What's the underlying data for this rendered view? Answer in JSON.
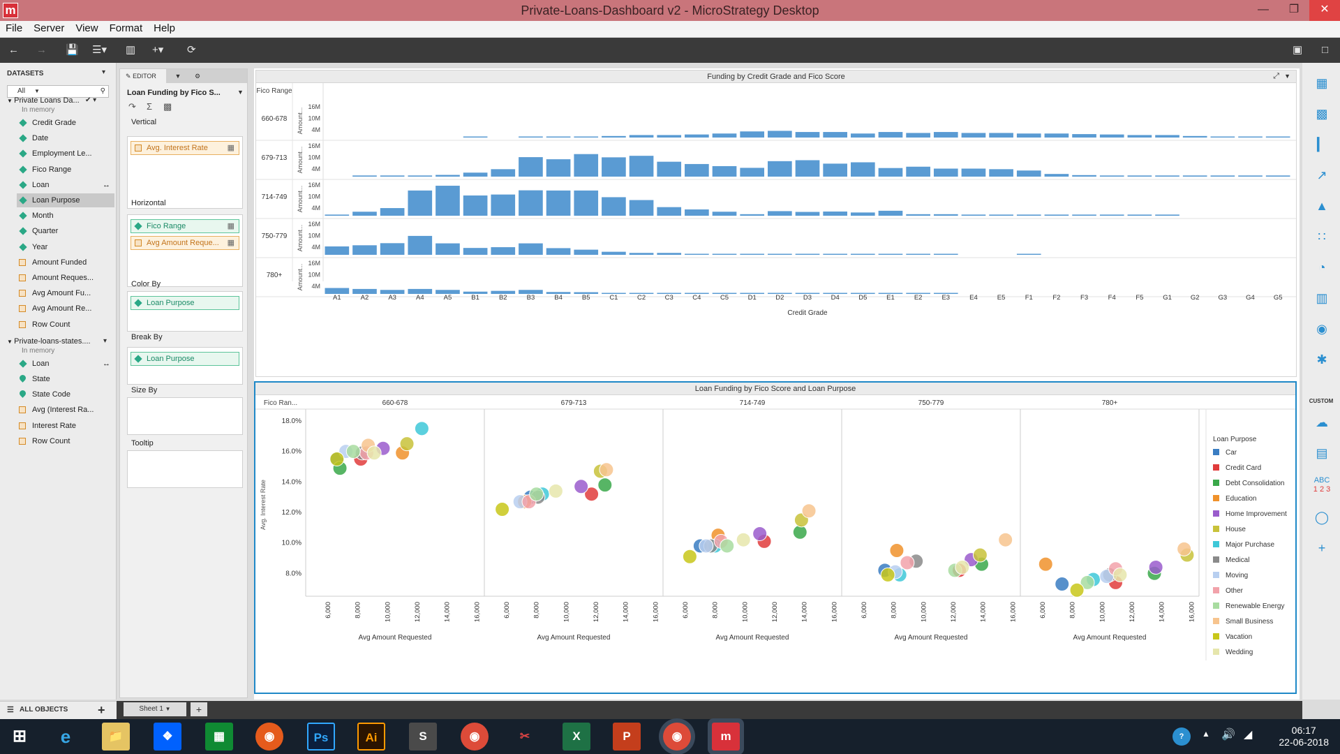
{
  "window": {
    "title": "Private-Loans-Dashboard v2 - MicroStrategy Desktop",
    "app_icon": "m"
  },
  "menu": [
    "File",
    "Server",
    "View",
    "Format",
    "Help"
  ],
  "datasets": {
    "header": "DATASETS",
    "filter": "All",
    "groups": [
      {
        "name": "Private Loans Da...",
        "status": "In memory",
        "items": [
          {
            "label": "Credit Grade",
            "kind": "attr"
          },
          {
            "label": "Date",
            "kind": "attr"
          },
          {
            "label": "Employment Le...",
            "kind": "attr"
          },
          {
            "label": "Fico Range",
            "kind": "attr"
          },
          {
            "label": "Loan",
            "kind": "attr"
          },
          {
            "label": "Loan Purpose",
            "kind": "attr",
            "selected": true
          },
          {
            "label": "Month",
            "kind": "attr"
          },
          {
            "label": "Quarter",
            "kind": "attr"
          },
          {
            "label": "Year",
            "kind": "attr"
          },
          {
            "label": "Amount Funded",
            "kind": "metric"
          },
          {
            "label": "Amount Reques...",
            "kind": "metric"
          },
          {
            "label": "Avg Amount Fu...",
            "kind": "metric"
          },
          {
            "label": "Avg Amount Re...",
            "kind": "metric"
          },
          {
            "label": "Row Count",
            "kind": "metric"
          }
        ]
      },
      {
        "name": "Private-loans-states....",
        "status": "In memory",
        "items": [
          {
            "label": "Loan",
            "kind": "attr"
          },
          {
            "label": "State",
            "kind": "geo"
          },
          {
            "label": "State Code",
            "kind": "geo"
          },
          {
            "label": "Avg (Interest Ra...",
            "kind": "metric"
          },
          {
            "label": "Interest Rate",
            "kind": "metric"
          },
          {
            "label": "Row Count",
            "kind": "metric"
          }
        ]
      }
    ],
    "all_objects": "ALL OBJECTS"
  },
  "editor": {
    "tab": "EDITOR",
    "title": "Loan Funding by Fico S...",
    "zones": [
      {
        "label": "Vertical",
        "pills": [
          {
            "text": "Avg. Interest Rate",
            "kind": "metric"
          }
        ]
      },
      {
        "label": "Horizontal",
        "pills": [
          {
            "text": "Fico Range",
            "kind": "attr"
          },
          {
            "text": "Avg Amount Reque...",
            "kind": "metric"
          }
        ]
      },
      {
        "label": "Color By",
        "pills": [
          {
            "text": "Loan Purpose",
            "kind": "attr"
          }
        ]
      },
      {
        "label": "Break By",
        "pills": [
          {
            "text": "Loan Purpose",
            "kind": "attr"
          }
        ]
      },
      {
        "label": "Size By",
        "pills": []
      },
      {
        "label": "Tooltip",
        "pills": []
      }
    ]
  },
  "sheet": {
    "tab": "Sheet 1"
  },
  "right_panel": {
    "custom_label": "CUSTOM",
    "abc_label": "ABC",
    "num_label": "1 2 3"
  },
  "taskbar": {
    "time": "06:17",
    "date": "22-06-2018"
  },
  "chart_data": [
    {
      "type": "bar",
      "title": "Funding by Credit Grade and Fico Score",
      "row_header": "Fico Range",
      "ylabel": "Amount...",
      "xlabel": "Credit Grade",
      "yticks": [
        "16M",
        "10M",
        "4M"
      ],
      "ylim": [
        0,
        19000000
      ],
      "categories": [
        "A1",
        "A2",
        "A3",
        "A4",
        "A5",
        "B1",
        "B2",
        "B3",
        "B4",
        "B5",
        "C1",
        "C2",
        "C3",
        "C4",
        "C5",
        "D1",
        "D2",
        "D3",
        "D4",
        "D5",
        "E1",
        "E2",
        "E3",
        "E4",
        "E5",
        "F1",
        "F2",
        "F3",
        "F4",
        "F5",
        "G1",
        "G2",
        "G3",
        "G4",
        "G5"
      ],
      "color": "#5a9bd3",
      "series": [
        {
          "name": "660-678",
          "values": [
            0,
            0,
            0,
            0,
            0,
            0.3,
            0,
            0.3,
            0.3,
            0.3,
            0.8,
            1.3,
            1.3,
            1.6,
            2.1,
            3.2,
            3.5,
            2.9,
            2.9,
            2.1,
            2.9,
            2.4,
            2.9,
            2.4,
            2.4,
            2.1,
            2.1,
            1.8,
            1.6,
            1.3,
            1.3,
            0.8,
            0.5,
            0.5,
            0.3
          ]
        },
        {
          "name": "679-713",
          "values": [
            0,
            0.6,
            0.6,
            0.6,
            0.9,
            2.1,
            3.9,
            10.2,
            9.1,
            11.8,
            10.1,
            10.9,
            7.8,
            6.6,
            5.5,
            4.6,
            8.1,
            8.6,
            6.8,
            7.5,
            4.5,
            5.2,
            4.2,
            4.2,
            3.9,
            3.2,
            1.4,
            0.8,
            0.6,
            0.6,
            0.6,
            0.6,
            0.6,
            0.6,
            0.6
          ]
        },
        {
          "name": "714-749",
          "values": [
            0.6,
            2.1,
            4.0,
            13.2,
            15.7,
            10.6,
            11.1,
            13.3,
            13.2,
            13.2,
            9.7,
            8.2,
            4.5,
            3.3,
            2.1,
            0.8,
            2.4,
            2.0,
            2.2,
            1.7,
            2.6,
            0.8,
            0.8,
            0.6,
            0.6,
            0.6,
            0.6,
            0.6,
            0.6,
            0.6,
            0.6,
            0,
            0,
            0,
            0
          ]
        },
        {
          "name": "750-779",
          "values": [
            4.4,
            5.0,
            6.1,
            9.9,
            6.0,
            3.6,
            4.0,
            6.0,
            3.5,
            2.7,
            1.6,
            1.0,
            1.0,
            0.4,
            0.4,
            0.4,
            0.4,
            0.4,
            0.4,
            0.4,
            0.4,
            0.3,
            0.3,
            0,
            0,
            0.3,
            0,
            0,
            0,
            0,
            0,
            0,
            0,
            0,
            0
          ]
        },
        {
          "name": "780+",
          "values": [
            3.1,
            2.6,
            2.1,
            2.6,
            2.1,
            1.2,
            1.6,
            2.1,
            1.0,
            0.9,
            0.5,
            0.5,
            0.3,
            0.3,
            0.2,
            0.2,
            0.2,
            0.2,
            0.2,
            0.2,
            0.2,
            0.1,
            0.3,
            0,
            0,
            0,
            0,
            0,
            0,
            0,
            0,
            0,
            0,
            0,
            0
          ]
        }
      ],
      "value_unit": "M"
    },
    {
      "type": "scatter",
      "title": "Loan Funding by Fico Score and Loan Purpose",
      "row_header": "Fico Ran...",
      "ylabel": "Avg. Interest Rate",
      "xlabel": "Avg Amount Requested",
      "ylim": [
        6.5,
        18.5
      ],
      "yticks": [
        "18.0%",
        "16.0%",
        "14.0%",
        "12.0%",
        "10.0%",
        "8.0%"
      ],
      "xlim": [
        4500,
        16500
      ],
      "xticks": [
        "6,000",
        "8,000",
        "10,000",
        "12,000",
        "14,000",
        "16,000"
      ],
      "legend_title": "Loan Purpose",
      "legend_position": "right",
      "purposes": [
        {
          "name": "Car",
          "color": "#3a7dc2"
        },
        {
          "name": "Credit Card",
          "color": "#e03c3c"
        },
        {
          "name": "Debt Consolidation",
          "color": "#3aa84a"
        },
        {
          "name": "Education",
          "color": "#f0922b"
        },
        {
          "name": "Home Improvement",
          "color": "#9a5ccc"
        },
        {
          "name": "House",
          "color": "#c8c23a"
        },
        {
          "name": "Major Purchase",
          "color": "#3ec8d8"
        },
        {
          "name": "Medical",
          "color": "#8a8a8a"
        },
        {
          "name": "Moving",
          "color": "#b8cff0"
        },
        {
          "name": "Other",
          "color": "#f2a2aa"
        },
        {
          "name": "Renewable Energy",
          "color": "#a8dca0"
        },
        {
          "name": "Small Business",
          "color": "#f7c48e"
        },
        {
          "name": "Vacation",
          "color": "#c8c71a"
        },
        {
          "name": "Wedding",
          "color": "#e6e6ac"
        }
      ],
      "panels": [
        {
          "name": "660-678",
          "points": [
            [
              6600,
              15.5
            ],
            [
              8200,
              15.5
            ],
            [
              6800,
              14.9
            ],
            [
              11000,
              15.9
            ],
            [
              9700,
              16.2
            ],
            [
              11300,
              16.5
            ],
            [
              12300,
              17.5
            ],
            [
              8300,
              15.9
            ],
            [
              7200,
              16.0
            ],
            [
              8600,
              15.9
            ],
            [
              7700,
              16.0
            ],
            [
              8700,
              16.4
            ],
            [
              6600,
              15.5
            ],
            [
              9100,
              15.9
            ]
          ]
        },
        {
          "name": "679-713",
          "points": [
            [
              7600,
              13.0
            ],
            [
              11700,
              13.2
            ],
            [
              12600,
              13.8
            ],
            [
              7200,
              12.7
            ],
            [
              11000,
              13.7
            ],
            [
              12300,
              14.7
            ],
            [
              8400,
              13.2
            ],
            [
              8100,
              13.0
            ],
            [
              6900,
              12.7
            ],
            [
              7500,
              12.7
            ],
            [
              8000,
              13.2
            ],
            [
              12700,
              14.8
            ],
            [
              5700,
              12.2
            ],
            [
              9300,
              13.4
            ]
          ]
        },
        {
          "name": "714-749",
          "points": [
            [
              7000,
              9.8
            ],
            [
              11300,
              10.1
            ],
            [
              13700,
              10.7
            ],
            [
              8200,
              10.5
            ],
            [
              11000,
              10.6
            ],
            [
              13800,
              11.5
            ],
            [
              8000,
              9.8
            ],
            [
              7700,
              9.8
            ],
            [
              7400,
              9.8
            ],
            [
              8400,
              10.1
            ],
            [
              8800,
              9.8
            ],
            [
              14300,
              12.1
            ],
            [
              6300,
              9.1
            ],
            [
              9900,
              10.2
            ]
          ]
        },
        {
          "name": "750-779",
          "points": [
            [
              7400,
              8.2
            ],
            [
              12400,
              8.2
            ],
            [
              13900,
              8.6
            ],
            [
              8200,
              9.5
            ],
            [
              13200,
              8.9
            ],
            [
              13800,
              9.2
            ],
            [
              8400,
              7.9
            ],
            [
              9500,
              8.8
            ],
            [
              8100,
              8.1
            ],
            [
              8900,
              8.7
            ],
            [
              12100,
              8.2
            ],
            [
              15500,
              10.2
            ],
            [
              7600,
              7.9
            ],
            [
              12600,
              8.4
            ]
          ]
        },
        {
          "name": "780+",
          "points": [
            [
              7300,
              7.3
            ],
            [
              10900,
              7.4
            ],
            [
              13500,
              8.0
            ],
            [
              6200,
              8.6
            ],
            [
              13600,
              8.4
            ],
            [
              15700,
              9.2
            ],
            [
              9400,
              7.6
            ],
            [
              10500,
              7.9
            ],
            [
              10300,
              7.8
            ],
            [
              10900,
              8.3
            ],
            [
              9000,
              7.4
            ],
            [
              15500,
              9.6
            ],
            [
              8300,
              6.9
            ],
            [
              11200,
              7.9
            ]
          ]
        }
      ]
    }
  ]
}
